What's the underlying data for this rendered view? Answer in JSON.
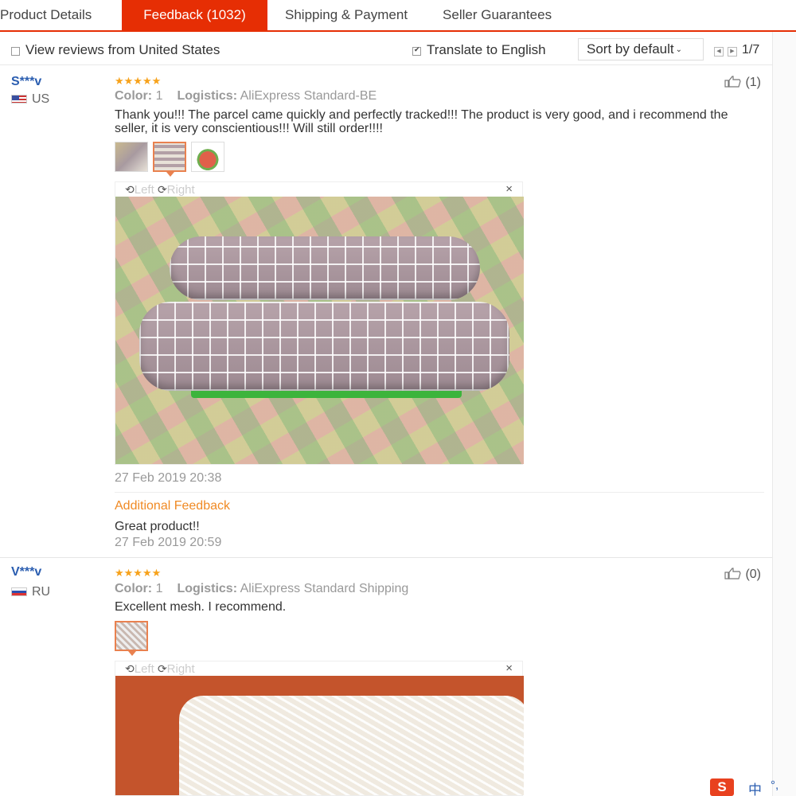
{
  "tabs": [
    {
      "label": "Product Details"
    },
    {
      "label": "Feedback (1032)"
    },
    {
      "label": "Shipping & Payment"
    },
    {
      "label": "Seller Guarantees"
    }
  ],
  "toolbar": {
    "view_us_label": "View reviews from United States",
    "view_us_checked": false,
    "translate_label": "Translate to English",
    "translate_checked": true,
    "sort_label": "Sort by default",
    "pagination": "1/7"
  },
  "reviews": [
    {
      "user": "S***v",
      "country": "US",
      "stars": "★★★★★",
      "color_label": "Color:",
      "color_value": "1",
      "logistics_label": "Logistics:",
      "logistics_value": "AliExpress Standard-BE",
      "likes": "(1)",
      "text": "Thank you!!! The parcel came quickly and perfectly tracked!!! The product is very good, and i recommend the seller, it is very conscientious!!! Will still order!!!!",
      "viewer": {
        "left": "Left",
        "right": "Right",
        "close": "×"
      },
      "date": "27 Feb 2019 20:38",
      "additional_title": "Additional Feedback",
      "additional_text": "Great product!!",
      "additional_date": "27 Feb 2019 20:59"
    },
    {
      "user": "V***v",
      "country": "RU",
      "stars": "★★★★★",
      "color_label": "Color:",
      "color_value": "1",
      "logistics_label": "Logistics:",
      "logistics_value": "AliExpress Standard Shipping",
      "likes": "(0)",
      "text": "Excellent mesh. I recommend.",
      "viewer": {
        "left": "Left",
        "right": "Right",
        "close": "×"
      }
    }
  ],
  "ime": {
    "logo": "S",
    "lang": "中",
    "mode": "°,"
  }
}
